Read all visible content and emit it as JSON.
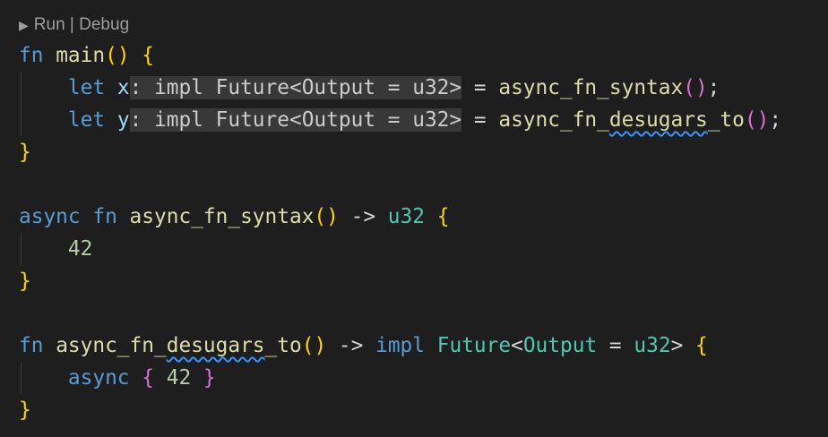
{
  "codelens": {
    "text": "Run | Debug",
    "run": "Run",
    "debug": "Debug"
  },
  "code": {
    "l1": {
      "kw": "fn",
      "name": "main",
      "parens": "()",
      "brace": "{"
    },
    "l2": {
      "kw": "let",
      "var": "x",
      "hint": ": impl Future<Output = u32>",
      "eq": "=",
      "call": "async_fn_syntax",
      "parens": "()",
      "semi": ";"
    },
    "l3": {
      "kw": "let",
      "var": "y",
      "hint": ": impl Future<Output = u32>",
      "eq": "=",
      "call_a": "async_fn_",
      "call_b": "desugars",
      "call_c": "_to",
      "parens": "()",
      "semi": ";"
    },
    "l4": {
      "brace": "}"
    },
    "l6": {
      "kw1": "async",
      "kw2": "fn",
      "name": "async_fn_syntax",
      "parens": "()",
      "arrow": "->",
      "ret": "u32",
      "brace": "{"
    },
    "l7": {
      "num": "42"
    },
    "l8": {
      "brace": "}"
    },
    "l10": {
      "kw1": "fn",
      "name_a": "async_fn_",
      "name_b": "desugars",
      "name_c": "_to",
      "parens": "()",
      "arrow": "->",
      "impl": "impl",
      "future": "Future",
      "lt": "<",
      "output": "Output",
      "eq": "=",
      "u32": "u32",
      "gt": ">",
      "brace": "{"
    },
    "l11": {
      "kw": "async",
      "open": "{",
      "num": "42",
      "close": "}"
    },
    "l12": {
      "brace": "}"
    }
  },
  "colors": {
    "background": "#1e1e1e",
    "keyword": "#569cd6",
    "function": "#dcdcaa",
    "variable": "#9cdcfe",
    "type": "#4ec9b0",
    "number": "#b5cea8",
    "bracket_level1": "#ffd700",
    "bracket_level2": "#da70d6",
    "inlay_hint_bg": "#383838",
    "squiggle": "#3794ff"
  }
}
